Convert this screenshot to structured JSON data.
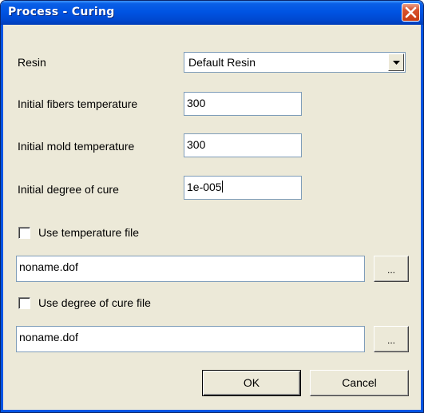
{
  "window": {
    "title": "Process - Curing",
    "close_icon": "close-x-icon"
  },
  "form": {
    "resin_label": "Resin",
    "resin_selected": "Default Resin",
    "fibers_temp_label": "Initial fibers temperature",
    "fibers_temp_value": "300",
    "mold_temp_label": "Initial mold temperature",
    "mold_temp_value": "300",
    "degree_cure_label": "Initial degree of cure",
    "degree_cure_value": "1e-005",
    "use_temp_file_label": "Use temperature file",
    "use_temp_file_checked": false,
    "temp_file_value": "noname.dof",
    "use_cure_file_label": "Use degree of cure file",
    "use_cure_file_checked": false,
    "cure_file_value": "noname.dof",
    "browse_label": "..."
  },
  "buttons": {
    "ok_label": "OK",
    "cancel_label": "Cancel"
  },
  "colors": {
    "titlebar": "#0054e3",
    "dialog_bg": "#ece9d8",
    "close_button": "#d9532e"
  }
}
